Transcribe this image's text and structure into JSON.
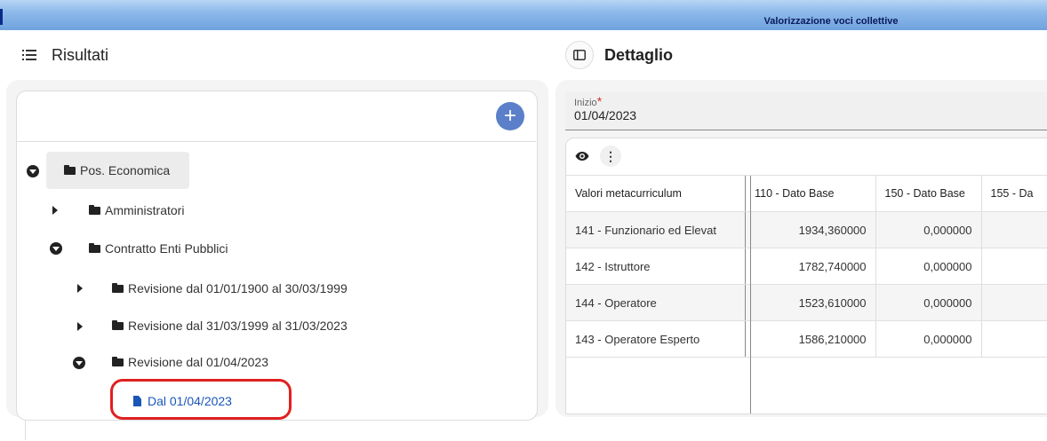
{
  "window": {
    "title": "Valorizzazione voci collettive"
  },
  "left_panel": {
    "header": {
      "icon": "list-icon",
      "title": "Risultati"
    },
    "add_button": {
      "icon": "plus-icon",
      "label": "+"
    },
    "tree": [
      {
        "label": "Pos. Economica",
        "type": "folder",
        "expanded": true
      },
      {
        "label": "Amministratori",
        "type": "folder",
        "expanded": false
      },
      {
        "label": "Contratto Enti Pubblici",
        "type": "folder",
        "expanded": true
      },
      {
        "label": "Revisione dal 01/01/1900 al 30/03/1999",
        "type": "folder",
        "expanded": false
      },
      {
        "label": "Revisione dal 31/03/1999 al 31/03/2023",
        "type": "folder",
        "expanded": false
      },
      {
        "label": "Revisione dal 01/04/2023",
        "type": "folder",
        "expanded": true
      },
      {
        "label": "Dal 01/04/2023",
        "type": "file",
        "highlighted": true
      }
    ]
  },
  "right_panel": {
    "header": {
      "icon": "panel-toggle-icon",
      "title": "Dettaglio"
    },
    "inizio": {
      "label": "Inizio",
      "required_marker": "*",
      "value": "01/04/2023"
    },
    "grid": {
      "toolbar": {
        "eye_icon": "eye-icon",
        "menu_label": "⋮"
      },
      "columns": [
        "Valori metacurriculum",
        "110 - Dato Base",
        "150 - Dato Base",
        "155 - Da"
      ],
      "rows": [
        [
          "141 - Funzionario ed Elevat",
          "1934,360000",
          "0,000000",
          ""
        ],
        [
          "142 - Istruttore",
          "1782,740000",
          "0,000000",
          ""
        ],
        [
          "144 - Operatore",
          "1523,610000",
          "0,000000",
          ""
        ],
        [
          "143 - Operatore Esperto",
          "1586,210000",
          "0,000000",
          ""
        ]
      ]
    }
  },
  "colors": {
    "accent": "#5b7fc9",
    "link": "#1a56b8",
    "highlight": "#e02020"
  }
}
